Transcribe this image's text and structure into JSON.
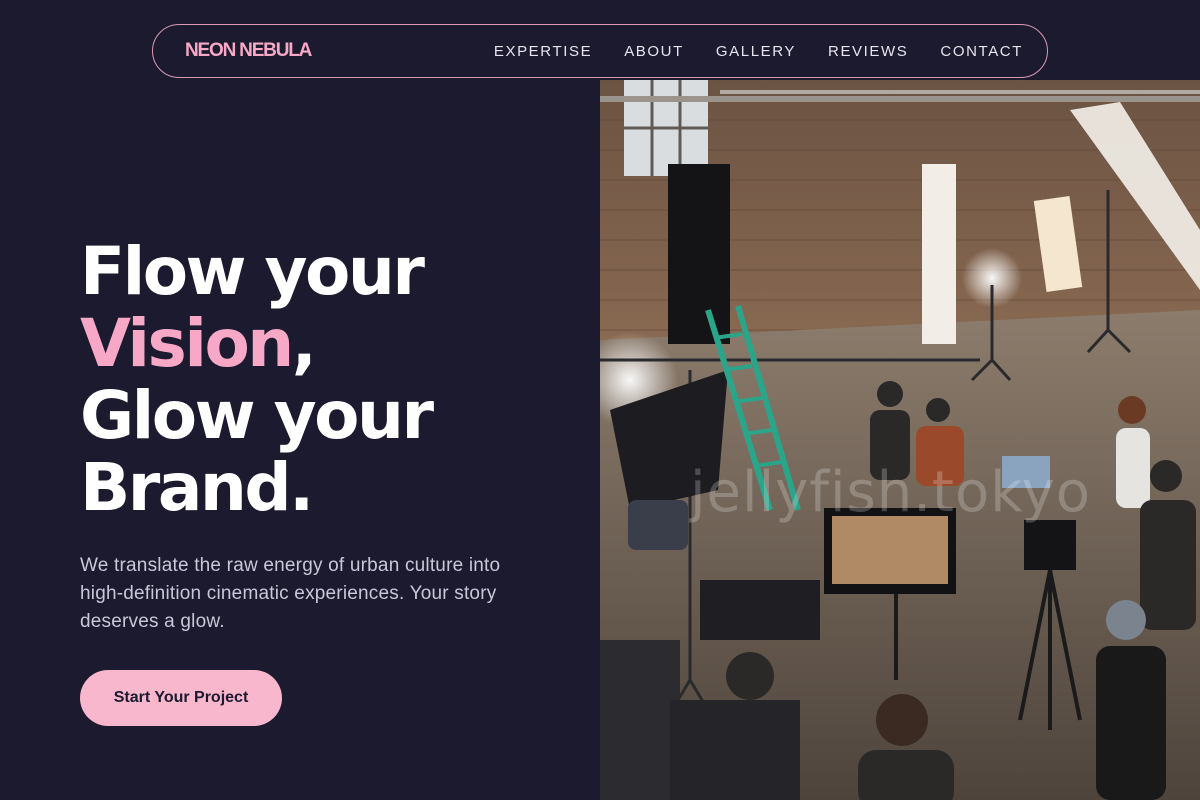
{
  "nav": {
    "brand": "NEON NEBULA",
    "links": [
      "EXPERTISE",
      "ABOUT",
      "GALLERY",
      "REVIEWS",
      "CONTACT"
    ]
  },
  "hero": {
    "line1": "Flow your",
    "line2_accent": "Vision",
    "line2_rest": ",",
    "line3": "Glow your",
    "line4": "Brand.",
    "subtitle": "We translate the raw energy of urban culture into high-definition cinematic experiences. Your story deserves a glow.",
    "cta_label": "Start Your Project"
  },
  "photo": {
    "watermark": "jellyfish.tokyo"
  },
  "colors": {
    "background": "#1b1a2e",
    "accent_pink": "#f7a8c6",
    "button_pink": "#f9b7cd"
  }
}
